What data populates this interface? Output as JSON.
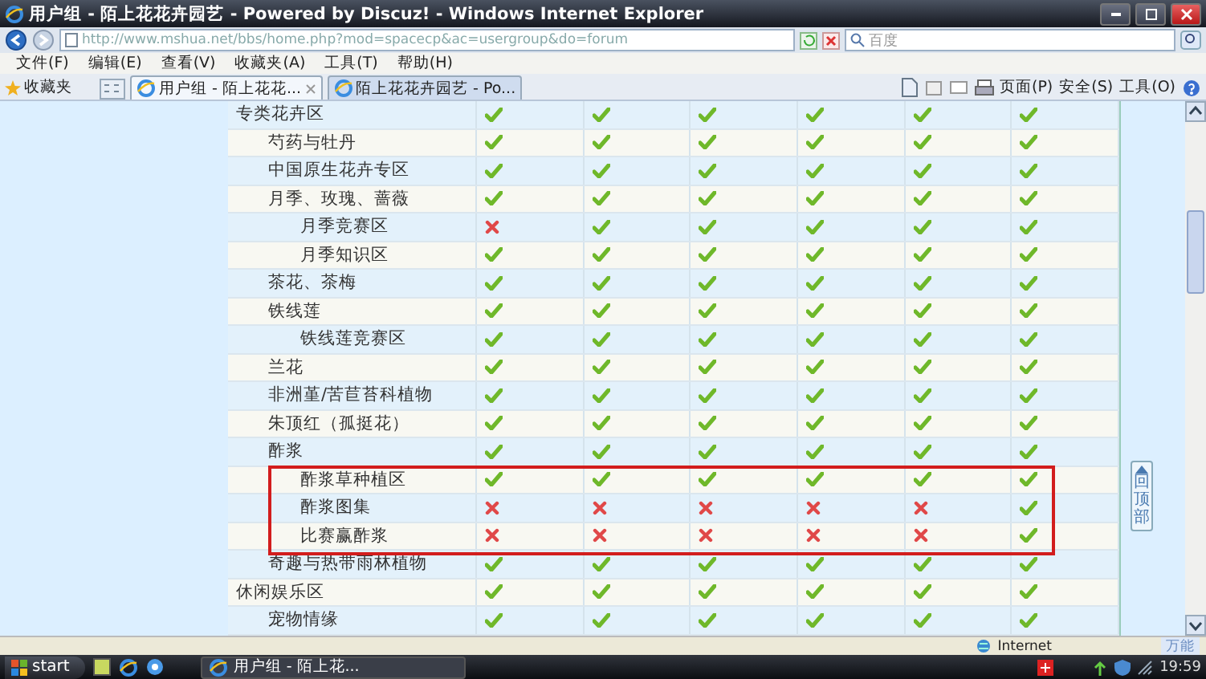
{
  "window": {
    "title": "用户组 - 陌上花花卉园艺 - Powered by Discuz! - Windows Internet Explorer"
  },
  "address_bar": {
    "url": "http://www.mshua.net/bbs/home.php?mod=spacecp&ac=usergroup&do=forum",
    "search_placeholder": "百度"
  },
  "menu": [
    "文件(F)",
    "编辑(E)",
    "查看(V)",
    "收藏夹(A)",
    "工具(T)",
    "帮助(H)"
  ],
  "favorites_label": "收藏夹",
  "tabs": [
    {
      "label": "用户组 - 陌上花花...",
      "selected": true,
      "closable": true
    },
    {
      "label": "陌上花花卉园艺 - Po...",
      "selected": false,
      "closable": false
    }
  ],
  "command_bar": [
    "页面(P)",
    "安全(S)",
    "工具(O)"
  ],
  "table": {
    "rows": [
      {
        "name": "专类花卉区",
        "circled": false,
        "permissions": [
          {
            "allowed": true
          },
          {
            "allowed": true
          },
          {
            "allowed": true
          },
          {
            "allowed": true
          },
          {
            "allowed": true
          },
          {
            "allowed": true
          }
        ],
        "children": [
          {
            "name": "芍药与牡丹",
            "circled": false,
            "permissions": [
              {
                "allowed": true
              },
              {
                "allowed": true
              },
              {
                "allowed": true
              },
              {
                "allowed": true
              },
              {
                "allowed": true
              },
              {
                "allowed": true
              }
            ]
          },
          {
            "name": "中国原生花卉专区",
            "circled": false,
            "permissions": [
              {
                "allowed": true
              },
              {
                "allowed": true
              },
              {
                "allowed": true
              },
              {
                "allowed": true
              },
              {
                "allowed": true
              },
              {
                "allowed": true
              }
            ]
          },
          {
            "name": "月季、玫瑰、蔷薇",
            "circled": false,
            "permissions": [
              {
                "allowed": true
              },
              {
                "allowed": true
              },
              {
                "allowed": true
              },
              {
                "allowed": true
              },
              {
                "allowed": true
              },
              {
                "allowed": true
              }
            ],
            "children": [
              {
                "name": "月季竞赛区",
                "circled": false,
                "permissions": [
                  {
                    "allowed": false
                  },
                  {
                    "allowed": true
                  },
                  {
                    "allowed": true
                  },
                  {
                    "allowed": true
                  },
                  {
                    "allowed": true
                  },
                  {
                    "allowed": true
                  }
                ]
              },
              {
                "name": "月季知识区",
                "circled": false,
                "permissions": [
                  {
                    "allowed": true
                  },
                  {
                    "allowed": true
                  },
                  {
                    "allowed": true
                  },
                  {
                    "allowed": true
                  },
                  {
                    "allowed": true
                  },
                  {
                    "allowed": true
                  }
                ]
              }
            ]
          },
          {
            "name": "茶花、茶梅",
            "circled": false,
            "permissions": [
              {
                "allowed": true
              },
              {
                "allowed": true
              },
              {
                "allowed": true
              },
              {
                "allowed": true
              },
              {
                "allowed": true
              },
              {
                "allowed": true
              }
            ]
          },
          {
            "name": "铁线莲",
            "circled": false,
            "permissions": [
              {
                "allowed": true
              },
              {
                "allowed": true
              },
              {
                "allowed": true
              },
              {
                "allowed": true
              },
              {
                "allowed": true
              },
              {
                "allowed": true
              }
            ],
            "children": [
              {
                "name": "铁线莲竞赛区",
                "circled": false,
                "permissions": [
                  {
                    "allowed": true
                  },
                  {
                    "allowed": true
                  },
                  {
                    "allowed": true
                  },
                  {
                    "allowed": true
                  },
                  {
                    "allowed": true
                  },
                  {
                    "allowed": true
                  }
                ]
              }
            ]
          },
          {
            "name": "兰花",
            "circled": false,
            "permissions": [
              {
                "allowed": true
              },
              {
                "allowed": true
              },
              {
                "allowed": true
              },
              {
                "allowed": true
              },
              {
                "allowed": true
              },
              {
                "allowed": true
              }
            ]
          },
          {
            "name": "非洲堇/苦苣苔科植物",
            "circled": false,
            "permissions": [
              {
                "allowed": true
              },
              {
                "allowed": true
              },
              {
                "allowed": true
              },
              {
                "allowed": true
              },
              {
                "allowed": true
              },
              {
                "allowed": true
              }
            ]
          },
          {
            "name": "朱顶红（孤挺花）",
            "circled": false,
            "permissions": [
              {
                "allowed": true
              },
              {
                "allowed": true
              },
              {
                "allowed": true
              },
              {
                "allowed": true
              },
              {
                "allowed": true
              },
              {
                "allowed": true
              }
            ]
          },
          {
            "name": "酢浆",
            "circled": false,
            "permissions": [
              {
                "allowed": true
              },
              {
                "allowed": true
              },
              {
                "allowed": true
              },
              {
                "allowed": true
              },
              {
                "allowed": true
              },
              {
                "allowed": true
              }
            ],
            "children": [
              {
                "name": "酢浆草种植区",
                "circled": true,
                "permissions": [
                  {
                    "allowed": true
                  },
                  {
                    "allowed": true
                  },
                  {
                    "allowed": true
                  },
                  {
                    "allowed": true
                  },
                  {
                    "allowed": true
                  },
                  {
                    "allowed": true
                  }
                ]
              },
              {
                "name": "酢浆图集",
                "circled": true,
                "permissions": [
                  {
                    "allowed": false
                  },
                  {
                    "allowed": false
                  },
                  {
                    "allowed": false
                  },
                  {
                    "allowed": false
                  },
                  {
                    "allowed": false
                  },
                  {
                    "allowed": true
                  }
                ]
              },
              {
                "name": "比赛赢酢浆",
                "circled": true,
                "permissions": [
                  {
                    "allowed": false
                  },
                  {
                    "allowed": false
                  },
                  {
                    "allowed": false
                  },
                  {
                    "allowed": false
                  },
                  {
                    "allowed": false
                  },
                  {
                    "allowed": true
                  }
                ]
              }
            ]
          },
          {
            "name": "奇趣与热带雨林植物",
            "circled": false,
            "permissions": [
              {
                "allowed": true
              },
              {
                "allowed": true
              },
              {
                "allowed": true
              },
              {
                "allowed": true
              },
              {
                "allowed": true
              },
              {
                "allowed": true
              }
            ]
          }
        ]
      },
      {
        "name": "休闲娱乐区",
        "circled": false,
        "permissions": [
          {
            "allowed": true
          },
          {
            "allowed": true
          },
          {
            "allowed": true
          },
          {
            "allowed": true
          },
          {
            "allowed": true
          },
          {
            "allowed": true
          }
        ],
        "children": [
          {
            "name": "宠物情缘",
            "circled": false,
            "permissions": [
              {
                "allowed": true
              },
              {
                "allowed": true
              },
              {
                "allowed": true
              },
              {
                "allowed": true
              },
              {
                "allowed": true
              },
              {
                "allowed": true
              }
            ]
          }
        ]
      }
    ]
  },
  "back_to_top": "回顶部",
  "status_bar": {
    "zone": "Internet",
    "extra": "万能"
  },
  "taskbar": {
    "start": "start",
    "task": "用户组 - 陌上花...",
    "clock": "19:59"
  }
}
